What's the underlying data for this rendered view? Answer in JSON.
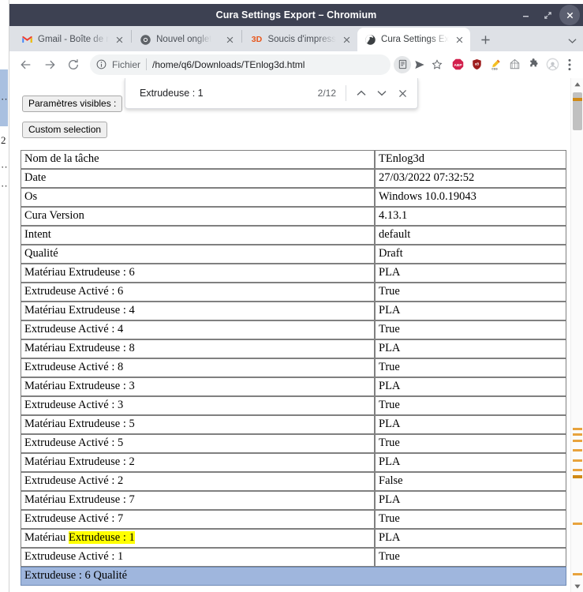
{
  "window": {
    "title": "Cura Settings Export – Chromium",
    "controls": {
      "minimize": "–",
      "maximize": "⤢",
      "close": "✕"
    }
  },
  "tabs": [
    {
      "title": "Gmail - Boîte de r",
      "favicon": "gmail-icon",
      "active": false,
      "close_label": "✕"
    },
    {
      "title": "Nouvel onglet",
      "favicon": "chromium-icon",
      "active": false,
      "close_label": "✕"
    },
    {
      "title": "Soucis d'impress",
      "favicon": "3d-icon",
      "favicon_text": "3D",
      "active": false,
      "close_label": "✕"
    },
    {
      "title": "Cura Settings Ex",
      "favicon": "globe-icon",
      "active": true,
      "close_label": "✕"
    }
  ],
  "tabstrip": {
    "new_tab_label": "+",
    "tab_list_label": "⌄"
  },
  "toolbar": {
    "back_label": "←",
    "forward_label": "→",
    "reload_label": "⟳",
    "scheme_label": "Fichier",
    "url": "/home/q6/Downloads/TEnlog3d.html",
    "menu_label": "⋮",
    "extensions": [
      "abp-icon",
      "ublock-icon",
      "css-pencil-icon",
      "wireframe-icon",
      "puzzle-icon",
      "profile-avatar-icon"
    ]
  },
  "findbar": {
    "query": "Extrudeuse : 1",
    "count": "2/12",
    "prev_label": "⌃",
    "next_label": "⌄",
    "close_label": "✕"
  },
  "page": {
    "buttons": {
      "visible_params": "Paramètres visibles :",
      "custom_selection": "Custom selection"
    },
    "rows": [
      {
        "key": "Nom de la tâche",
        "value": "TEnlog3d"
      },
      {
        "key": "Date",
        "value": "27/03/2022 07:32:52"
      },
      {
        "key": "Os",
        "value": "Windows 10.0.19043"
      },
      {
        "key": "Cura Version",
        "value": "4.13.1"
      },
      {
        "key": "Intent",
        "value": "default"
      },
      {
        "key": "Qualité",
        "value": "Draft"
      },
      {
        "key": "Matériau Extrudeuse : 6",
        "value": "PLA"
      },
      {
        "key": "Extrudeuse Activé : 6",
        "value": "True"
      },
      {
        "key": "Matériau Extrudeuse : 4",
        "value": "PLA"
      },
      {
        "key": "Extrudeuse Activé : 4",
        "value": "True"
      },
      {
        "key": "Matériau Extrudeuse : 8",
        "value": "PLA"
      },
      {
        "key": "Extrudeuse Activé : 8",
        "value": "True"
      },
      {
        "key": "Matériau Extrudeuse : 3",
        "value": "PLA"
      },
      {
        "key": "Extrudeuse Activé : 3",
        "value": "True"
      },
      {
        "key": "Matériau Extrudeuse : 5",
        "value": "PLA"
      },
      {
        "key": "Extrudeuse Activé : 5",
        "value": "True"
      },
      {
        "key": "Matériau Extrudeuse : 2",
        "value": "PLA"
      },
      {
        "key": "Extrudeuse Activé : 2",
        "value": "False"
      },
      {
        "key": "Matériau Extrudeuse : 7",
        "value": "PLA"
      },
      {
        "key": "Extrudeuse Activé : 7",
        "value": "True"
      },
      {
        "key": "Matériau ",
        "key_highlight": "Extrudeuse : 1",
        "value": "PLA",
        "highlighted": true
      },
      {
        "key": "Extrudeuse Activé : 1",
        "value": "True"
      }
    ],
    "selected_row": "Extrudeuse : 6 Qualité"
  },
  "background_window": {
    "cut_text": [
      "··",
      "2",
      "··",
      "··"
    ]
  },
  "colors": {
    "titlebar": "#3d4152",
    "tabstrip": "#dee1e6",
    "find_highlight": "#ffff00",
    "selection_blue": "#9fb6dd",
    "scroll_tick": "#e8a33d",
    "table_border": "#808080"
  }
}
